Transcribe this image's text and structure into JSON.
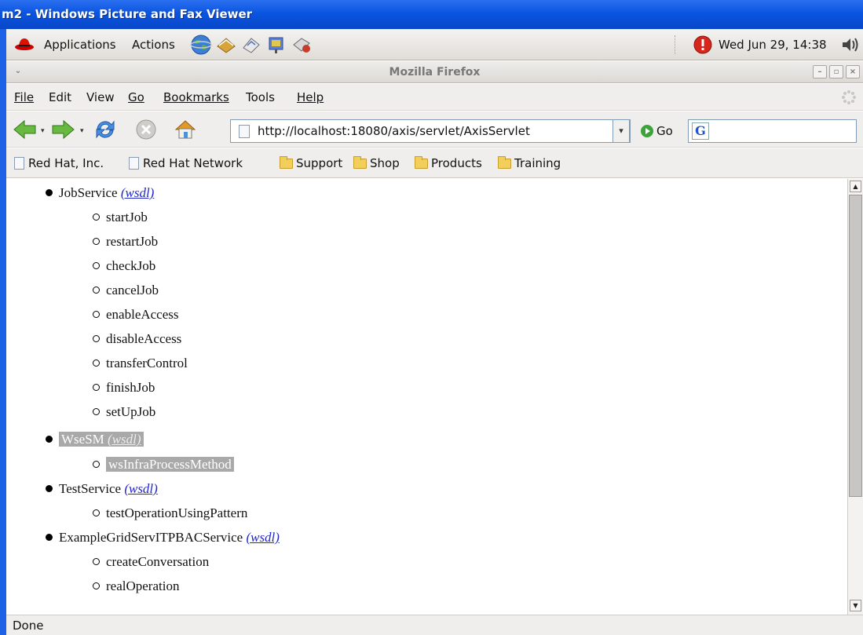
{
  "outer_window": {
    "title": "m2 - Windows Picture and Fax Viewer"
  },
  "gnome_panel": {
    "applications": "Applications",
    "actions": "Actions",
    "clock": "Wed Jun 29, 14:38"
  },
  "firefox": {
    "title": "Mozilla Firefox",
    "menu": [
      "File",
      "Edit",
      "View",
      "Go",
      "Bookmarks",
      "Tools",
      "Help"
    ],
    "url": "http://localhost:18080/axis/servlet/AxisServlet",
    "go_label": "Go",
    "search_value": "",
    "bookmarks": [
      {
        "label": "Red Hat, Inc.",
        "type": "page"
      },
      {
        "label": "Red Hat Network",
        "type": "page"
      },
      {
        "label": "Support",
        "type": "folder"
      },
      {
        "label": "Shop",
        "type": "folder"
      },
      {
        "label": "Products",
        "type": "folder"
      },
      {
        "label": "Training",
        "type": "folder"
      }
    ],
    "status": "Done"
  },
  "content": {
    "wsdl_label": "(wsdl)",
    "services": [
      {
        "name": "JobService",
        "operations": [
          "startJob",
          "restartJob",
          "checkJob",
          "cancelJob",
          "enableAccess",
          "disableAccess",
          "transferControl",
          "finishJob",
          "setUpJob"
        ]
      },
      {
        "name": "WseSM",
        "operations": [
          "wsInfraProcessMethod"
        ]
      },
      {
        "name": "TestService",
        "operations": [
          "testOperationUsingPattern"
        ]
      },
      {
        "name": "ExampleGridServITPBACService",
        "operations": [
          "createConversation",
          "realOperation"
        ]
      }
    ]
  },
  "colors": {
    "xp_title": "#0a55e0",
    "link": "#2228c9",
    "selection": "#a9a9a9"
  }
}
